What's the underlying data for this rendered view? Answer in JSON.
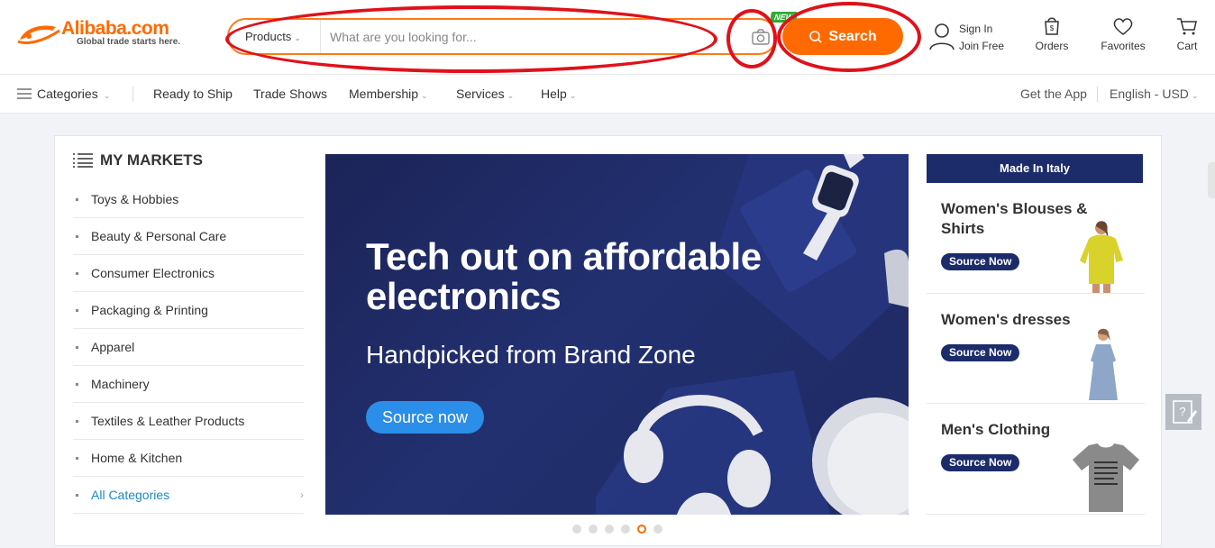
{
  "header": {
    "logo_text": "Alibaba.com",
    "logo_tagline": "Global trade starts here.",
    "search": {
      "category": "Products",
      "placeholder": "What are you looking for...",
      "value": "",
      "new_badge": "NEW",
      "button_label": "Search"
    },
    "user": {
      "sign_in": "Sign In",
      "join": "Join Free"
    },
    "tools": {
      "orders": "Orders",
      "favorites": "Favorites",
      "cart": "Cart"
    },
    "colors": {
      "accent": "#ff6a00",
      "annotation": "#e0111a"
    }
  },
  "nav": {
    "categories": "Categories",
    "ready_to_ship": "Ready to Ship",
    "trade_shows": "Trade Shows",
    "membership": "Membership",
    "services": "Services",
    "help": "Help",
    "get_app": "Get the App",
    "language": "English - USD"
  },
  "markets": {
    "heading": "MY MARKETS",
    "items": [
      "Toys & Hobbies",
      "Beauty & Personal Care",
      "Consumer Electronics",
      "Packaging & Printing",
      "Apparel",
      "Machinery",
      "Textiles & Leather Products",
      "Home & Kitchen",
      "All Categories"
    ]
  },
  "banner": {
    "title": "Tech out on affordable electronics",
    "subtitle": "Handpicked from Brand Zone",
    "cta": "Source now",
    "slide_count": 6,
    "active_slide": 5
  },
  "side": {
    "heading": "Made In Italy",
    "cards": [
      {
        "title": "Women's Blouses & Shirts",
        "button": "Source Now"
      },
      {
        "title": "Women's dresses",
        "button": "Source Now"
      },
      {
        "title": "Men's Clothing",
        "button": "Source Now"
      }
    ]
  }
}
